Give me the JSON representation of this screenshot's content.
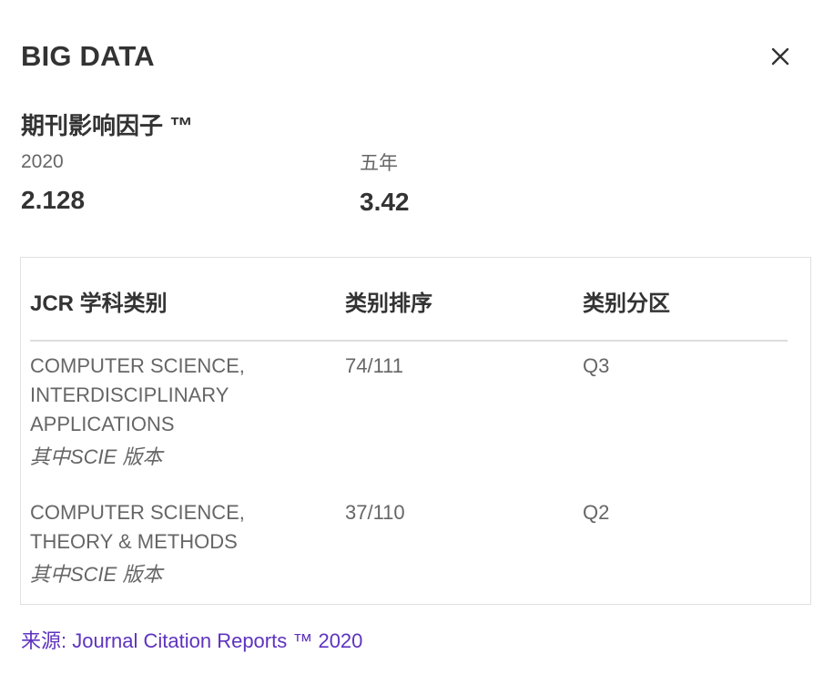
{
  "header": {
    "journal_title": "BIG DATA",
    "close_icon": "close-icon"
  },
  "impact_factor": {
    "heading": "期刊影响因子 ™",
    "metrics": [
      {
        "label": "2020",
        "value": "2.128"
      },
      {
        "label": "五年",
        "value": "3.42"
      }
    ]
  },
  "jcr_table": {
    "headers": [
      "JCR 学科类别",
      "类别排序",
      "类别分区"
    ],
    "rows": [
      {
        "category": "COMPUTER SCIENCE, INTERDISCIPLINARY APPLICATIONS",
        "edition": "其中SCIE 版本",
        "rank": "74/111",
        "quartile": "Q3"
      },
      {
        "category": "COMPUTER SCIENCE, THEORY & METHODS",
        "edition": "其中SCIE 版本",
        "rank": "37/110",
        "quartile": "Q2"
      }
    ]
  },
  "source": {
    "text": "来源: Journal Citation Reports ™ 2020",
    "color": "#5e33bf"
  }
}
